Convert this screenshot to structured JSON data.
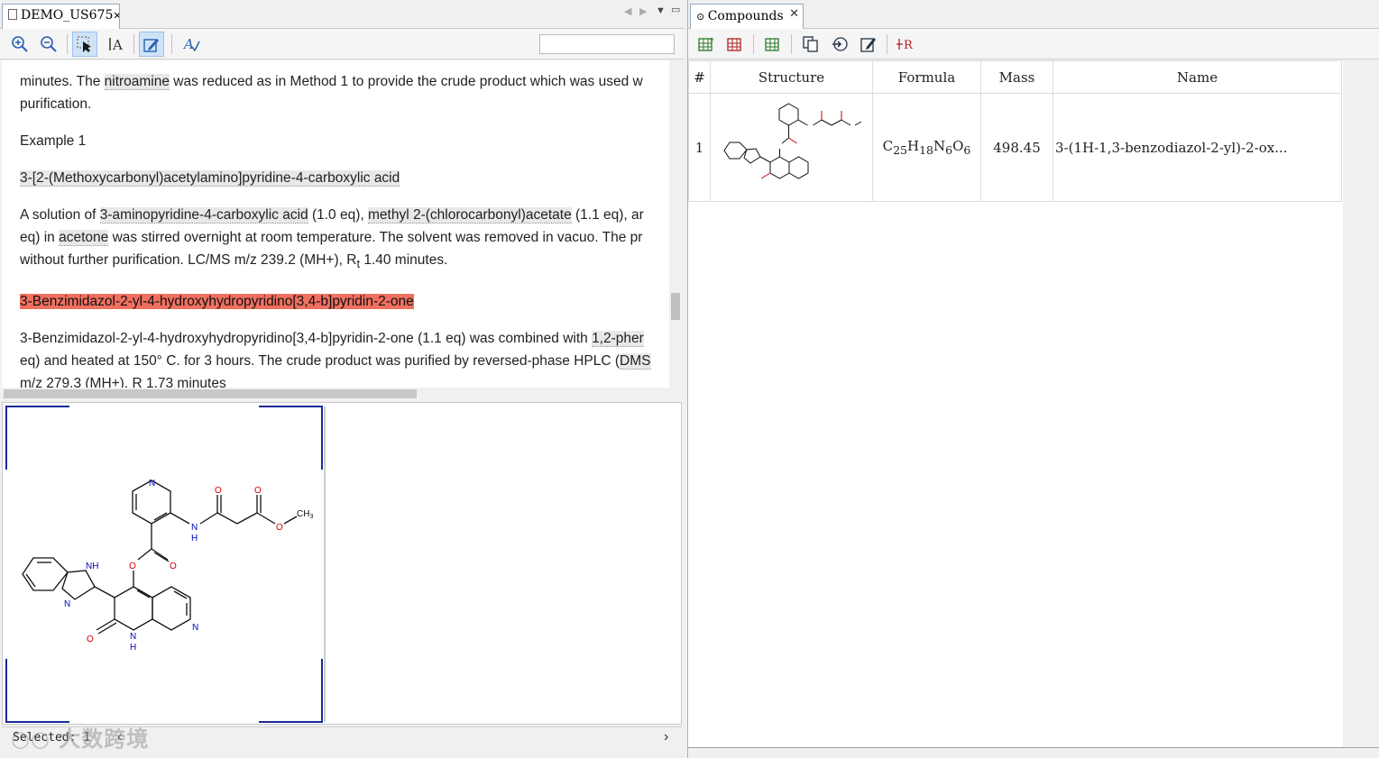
{
  "left": {
    "tab_title": "DEMO_US675",
    "text_lines": {
      "l1a": "minutes. The ",
      "l1b": "nitroamine",
      "l1c": " was reduced as in Method 1 to provide the crude product which was used w",
      "l2": "purification.",
      "l3": "Example 1",
      "l4": "3-[2-(Methoxycarbonyl)acetylamino]pyridine-4-carboxylic acid",
      "l5a": "A solution of ",
      "l5b": "3-aminopyridine-4-carboxylic acid",
      "l5c": " (1.0 eq), ",
      "l5d": "methyl 2-(chlorocarbonyl)acetate",
      "l5e": " (1.1 eq), ar",
      "l6a": "eq) in ",
      "l6b": "acetone",
      "l6c": " was stirred overnight at room temperature. The solvent was removed in vacuo. The pr",
      "l7a": "without further purification. LC/MS m/z 239.2 (MH+), R",
      "l7sub": "t",
      "l7b": " 1.40 minutes.",
      "l8": "3-Benzimidazol-2-yl-4-hydroxyhydropyridino[3,4-b]pyridin-2-one",
      "l9a": "3-Benzimidazol-2-yl-4-hydroxyhydropyridino[3,4-b]pyridin-2-one (1.1 eq) was combined with ",
      "l9b": "1,2-pher",
      "l10a": "eq) and heated at 150° C. for 3 hours. The crude product was purified by reversed-phase HPLC (",
      "l10b": "DMS",
      "l11": "m/z 279.3 (MH+), R  1.73 minutes"
    },
    "status": "Selected: 1"
  },
  "right": {
    "tab_title": "Compounds",
    "columns": [
      "#",
      "Structure",
      "Formula",
      "Mass",
      "Name"
    ],
    "rows": [
      {
        "index": "1",
        "formula_parts": [
          "C",
          "25",
          "H",
          "18",
          "N",
          "6",
          "O",
          "6"
        ],
        "mass": "498.45",
        "name": "3-(1H-1,3-benzodiazol-2-yl)-2-ox..."
      }
    ]
  },
  "molecule_labels": {
    "n_top": "N",
    "o1": "O",
    "o2": "O",
    "nh_amide": "N",
    "h_amide": "H",
    "o_ester": "O",
    "ch3": "CH",
    "ch3_sub": "3",
    "nh_benz": "NH",
    "n_benz": "N",
    "o_link": "O",
    "o_carbonyl": "O",
    "n_pyr": "N",
    "o_keto": "O",
    "nh_ring": "N",
    "h_ring": "H"
  },
  "watermark": "大数跨境",
  "colors": {
    "highlight": "#f07060",
    "selection_frame": "#1a2a9a",
    "oxygen": "#d00000",
    "nitrogen": "#0000c0"
  }
}
